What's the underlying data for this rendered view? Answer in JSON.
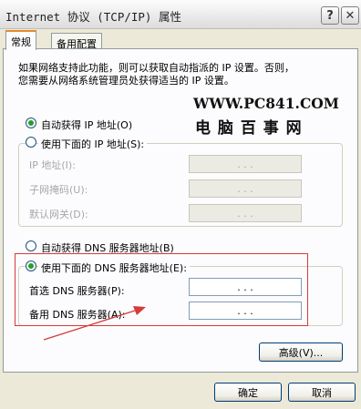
{
  "window": {
    "title": "Internet 协议 (TCP/IP) 属性",
    "help_glyph": "?",
    "close_glyph": "✕"
  },
  "tabs": [
    {
      "label": "常规",
      "active": true
    },
    {
      "label": "备用配置",
      "active": false
    }
  ],
  "description": {
    "line1": "如果网络支持此功能，则可以获取自动指派的 IP 设置。否则，",
    "line2": "您需要从网络系统管理员处获得适当的 IP 设置。"
  },
  "watermark": {
    "url": "WWW.PC841.COM",
    "name": "电 脑 百 事 网"
  },
  "ip": {
    "auto_label": "自动获得 IP 地址(O)",
    "manual_label": "使用下面的 IP 地址(S):",
    "auto_selected": true,
    "fields": [
      {
        "label": "IP 地址(I):",
        "value": ". . ."
      },
      {
        "label": "子网掩码(U):",
        "value": ". . ."
      },
      {
        "label": "默认网关(D):",
        "value": ". . ."
      }
    ]
  },
  "dns": {
    "auto_label": "自动获得 DNS 服务器地址(B)",
    "manual_label": "使用下面的 DNS 服务器地址(E):",
    "manual_selected": true,
    "fields": [
      {
        "label": "首选 DNS 服务器(P):",
        "value": ". . ."
      },
      {
        "label": "备用 DNS 服务器(A):",
        "value": ". . ."
      }
    ]
  },
  "buttons": {
    "advanced": "高级(V)...",
    "ok": "确定",
    "cancel": "取消"
  },
  "colors": {
    "highlight": "#d63a3a",
    "radio_dot": "#21a121",
    "tab_accent": "#e68b2c"
  }
}
